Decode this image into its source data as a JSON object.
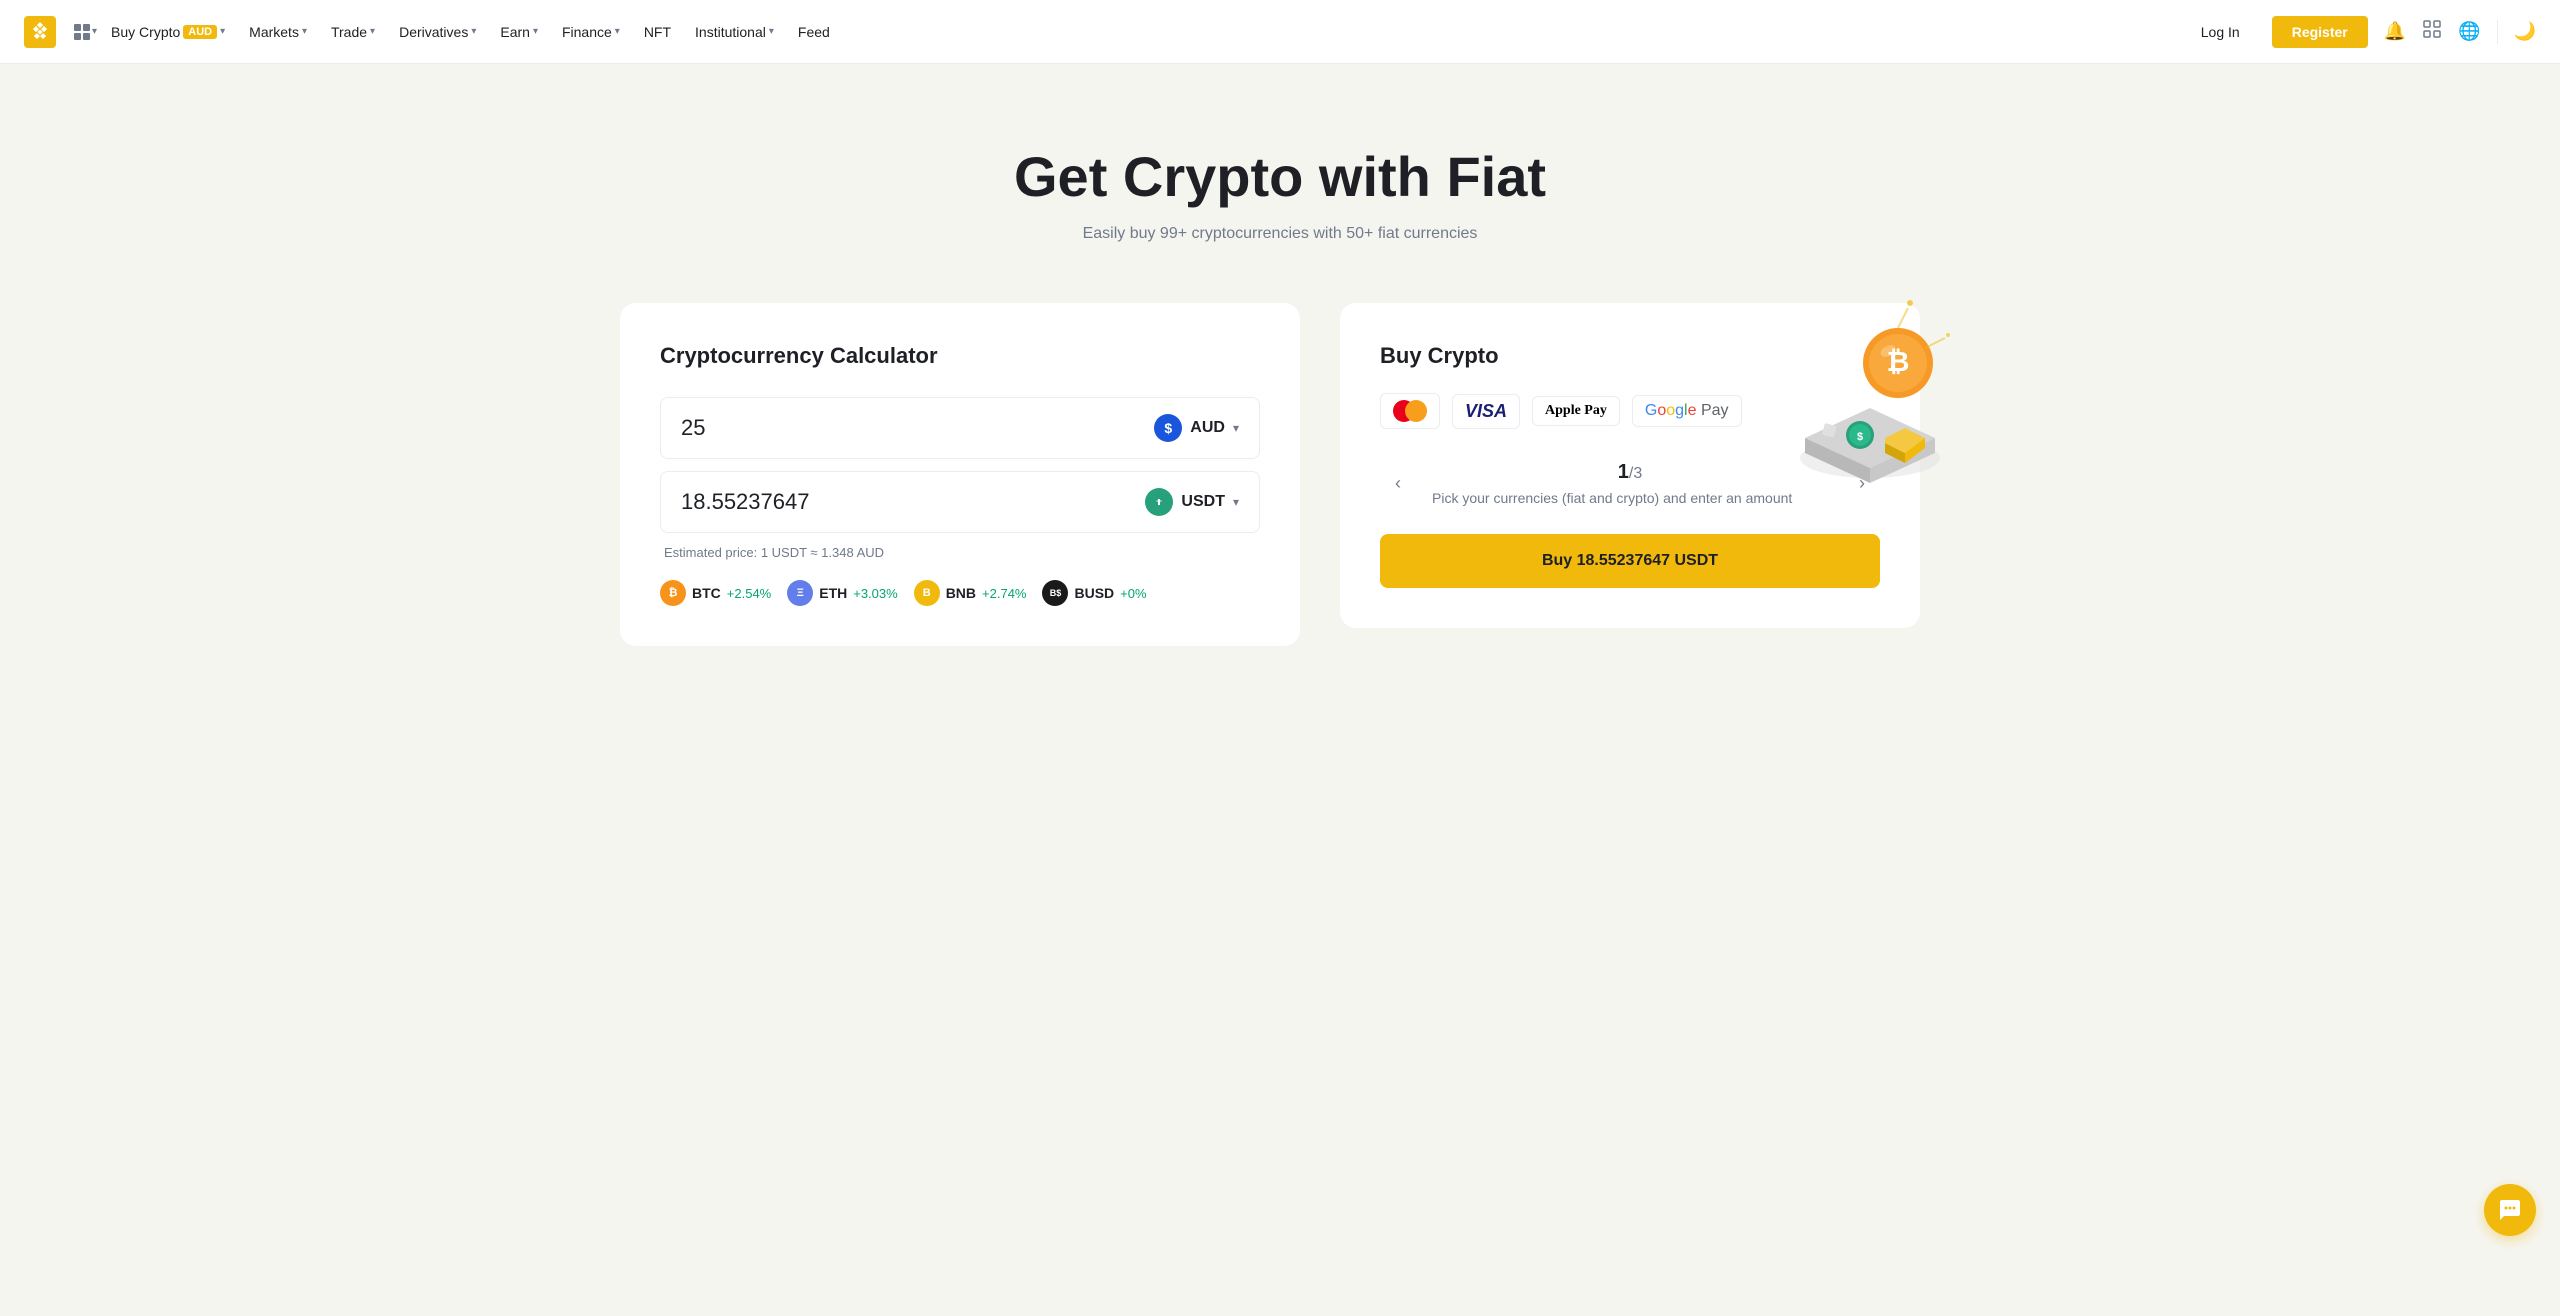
{
  "nav": {
    "logo_alt": "Binance",
    "items": [
      {
        "id": "buy-crypto",
        "label": "Buy Crypto",
        "badge": "AUD",
        "has_dropdown": true
      },
      {
        "id": "markets",
        "label": "Markets",
        "has_dropdown": true
      },
      {
        "id": "trade",
        "label": "Trade",
        "has_dropdown": true
      },
      {
        "id": "derivatives",
        "label": "Derivatives",
        "has_dropdown": true
      },
      {
        "id": "earn",
        "label": "Earn",
        "has_dropdown": true
      },
      {
        "id": "finance",
        "label": "Finance",
        "has_dropdown": true
      },
      {
        "id": "nft",
        "label": "NFT",
        "has_dropdown": false
      },
      {
        "id": "institutional",
        "label": "Institutional",
        "has_dropdown": true
      },
      {
        "id": "feed",
        "label": "Feed",
        "has_dropdown": false
      }
    ],
    "login_label": "Log In",
    "register_label": "Register"
  },
  "hero": {
    "title": "Get Crypto with Fiat",
    "subtitle": "Easily buy 99+ cryptocurrencies with 50+ fiat currencies"
  },
  "calculator": {
    "title": "Cryptocurrency Calculator",
    "input_value": "25",
    "input_currency": "AUD",
    "output_value": "18.55237647",
    "output_currency": "USDT",
    "estimated_price": "Estimated price: 1 USDT ≈ 1.348 AUD",
    "cryptos": [
      {
        "symbol": "BTC",
        "change": "+2.54%",
        "positive": true
      },
      {
        "symbol": "ETH",
        "change": "+3.03%",
        "positive": true
      },
      {
        "symbol": "BNB",
        "change": "+2.74%",
        "positive": true
      },
      {
        "symbol": "BUSD",
        "change": "+0%",
        "positive": true
      }
    ]
  },
  "buy_crypto": {
    "title": "Buy Crypto",
    "payment_methods": [
      "Mastercard",
      "Visa",
      "Apple Pay",
      "Google Pay"
    ],
    "slider_current": "1",
    "slider_total": "3",
    "slider_desc": "Pick your currencies (fiat and crypto) and enter an amount",
    "buy_button_label": "Buy 18.55237647 USDT",
    "prev_arrow": "‹",
    "next_arrow": "›"
  },
  "chat": {
    "icon": "💬"
  }
}
